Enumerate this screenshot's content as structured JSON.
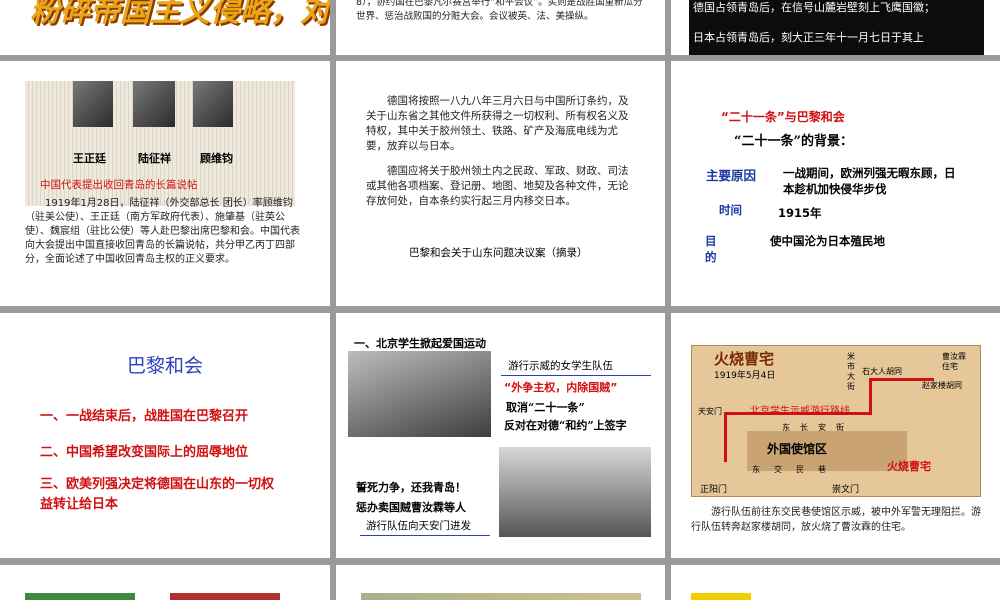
{
  "s1": {
    "banner": "粉碎帝国主义侵略，对外争权"
  },
  "s2": {
    "text": "8），协约国在巴黎凡尔赛宫举行“和平会议”。实则是战胜国重新瓜分世界、惩治战败国的分赃大会。会议被英、法、美操纵。"
  },
  "s3": {
    "line1": "德国占领青岛后，在信号山麓岩壁刻上飞鹰国徽；",
    "line2": "日本占领青岛后，刻大正三年十一月七日于其上"
  },
  "s4": {
    "names": [
      "王正廷",
      "陆征祥",
      "顾维钧"
    ],
    "caption": "中国代表提出收回青岛的长篇说帖",
    "body": "1919年1月28日，陆征祥（外交部总长 团长）率顾维钧（驻美公使）、王正廷（南方军政府代表）、施肇基（驻英公使）、魏宸组（驻比公使）等人赴巴黎出席巴黎和会。中国代表向大会提出中国直接收回青岛的长篇说帖，共分甲乙丙丁四部分，全面论述了中国收回青岛主权的正义要求。"
  },
  "s5": {
    "p1": "德国将按照一八九八年三月六日与中国所订条约，及关于山东省之其他文件所获得之一切权利、所有权名义及特权，其中关于胶州领土、铁路、矿产及海底电线为尤要，放弃以与日本。",
    "p2": "德国应将关于胶州领土内之民政、军政、财政、司法或其他各项档案、登记册、地图、地契及各种文件，无论存放何处，自本条约实行起三月内移交日本。",
    "caption": "巴黎和会关于山东问题决议案（摘录）"
  },
  "s6": {
    "title": "“二十一条”与巴黎和会",
    "subtitle": "“二十一条”的背景：",
    "row1_label": "主要原因",
    "row1_text": "一战期间，欧洲列强无暇东顾，日本趁机加快侵华步伐",
    "row2_label": "时间",
    "row2_text": "1915年",
    "row3_label": "目的",
    "row3_text": "使中国沦为日本殖民地"
  },
  "s7": {
    "title": "巴黎和会",
    "items": [
      "一、一战结束后，战胜国在巴黎召开",
      "二、中国希望改变国际上的屈辱地位",
      "三、欧美列强决定将德国在山东的一切权益转让给日本"
    ]
  },
  "s8": {
    "heading": "一、北京学生掀起爱国运动",
    "label1": "游行示威的女学生队伍",
    "slogan1": "“外争主权，内除国贼”",
    "slogan2": "取消“二十一条”",
    "slogan3": "反对在对德“和约”上签字",
    "slogan4": "誓死力争，还我青岛！",
    "slogan5": "惩办卖国贼曹汝霖等人",
    "label2": "游行队伍向天安门进发"
  },
  "s9": {
    "map_title": "火烧曹宅",
    "map_date": "1919年5月4日",
    "route_label": "北京学生示威游行路线",
    "places": [
      "曹汝霖住宅",
      "石大人胡同",
      "赵家楼胡同",
      "米市大街",
      "东长安街",
      "东交民巷",
      "外国使馆区",
      "天安门",
      "正阳门",
      "崇文门",
      "火烧曹宅"
    ],
    "text": "游行队伍前往东交民巷使馆区示威，被中外军警无理阻拦。游行队伍转奔赵家楼胡同，放火烧了曹汝霖的住宅。"
  },
  "colors": {
    "red": "#d01010",
    "blue": "#1a3aa0",
    "map": "#e6c79a"
  }
}
